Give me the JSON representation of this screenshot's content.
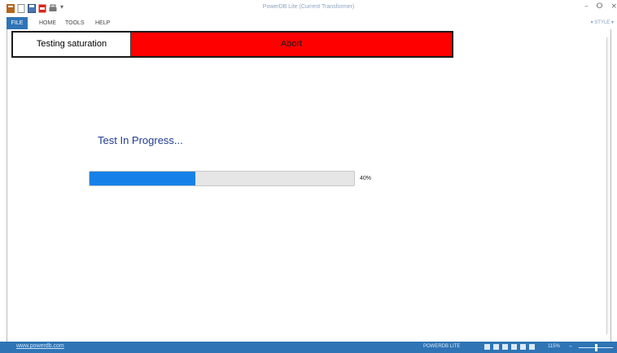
{
  "window": {
    "title": "PowerDB Lite (Current Transformer)",
    "minimize": "–",
    "restore": "ⵔ",
    "close": "×"
  },
  "quick_access": {
    "icons": [
      "app-icon",
      "new-document-icon",
      "save-icon",
      "pdf-icon",
      "print-icon"
    ],
    "caret": "▾"
  },
  "ribbon": {
    "tabs": [
      "FILE",
      "HOME",
      "TOOLS",
      "HELP"
    ],
    "style_menu": "▾ STYLE ▾"
  },
  "test": {
    "status_label": "Testing saturation",
    "abort_label": "Abort"
  },
  "progress": {
    "heading": "Test In Progress...",
    "percent_text": "40%",
    "value": 0.4
  },
  "statusbar": {
    "link": "www.powerdb.com",
    "app_name": "POWERDB LITE",
    "zoom": "115%",
    "zoom_minus": "–",
    "zoom_fraction": 0.5
  },
  "colors": {
    "accent": "#2f74b5",
    "abort_red": "#ff0000",
    "progress_blue": "#1581e8",
    "heading_blue": "#1f3b8f"
  }
}
